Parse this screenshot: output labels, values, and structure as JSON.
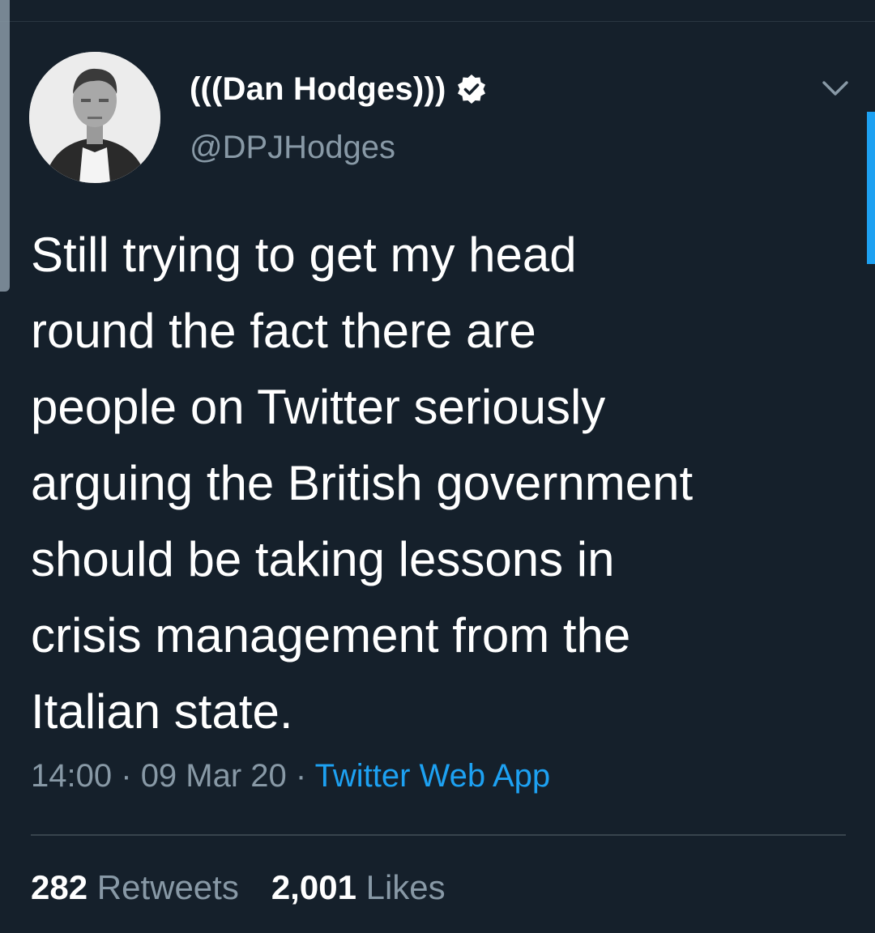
{
  "tweet": {
    "author": {
      "display_name": "(((Dan Hodges)))",
      "handle": "@DPJHodges",
      "verified": true,
      "verified_icon": "verified-badge-icon"
    },
    "text_lines": [
      "Still trying to get my head",
      "round the fact there are",
      "people on Twitter seriously",
      "arguing the British government",
      "should be taking lessons in",
      "crisis management from the",
      "Italian state."
    ],
    "time": "14:00",
    "separator": "·",
    "date": "09 Mar 20",
    "source": "Twitter Web App",
    "stats": {
      "retweets_count": "282",
      "retweets_label": "Retweets",
      "likes_count": "2,001",
      "likes_label": "Likes"
    }
  },
  "colors": {
    "background": "#15202b",
    "secondary_text": "#8899a6",
    "accent": "#1da1f2",
    "divider": "#38444d"
  }
}
